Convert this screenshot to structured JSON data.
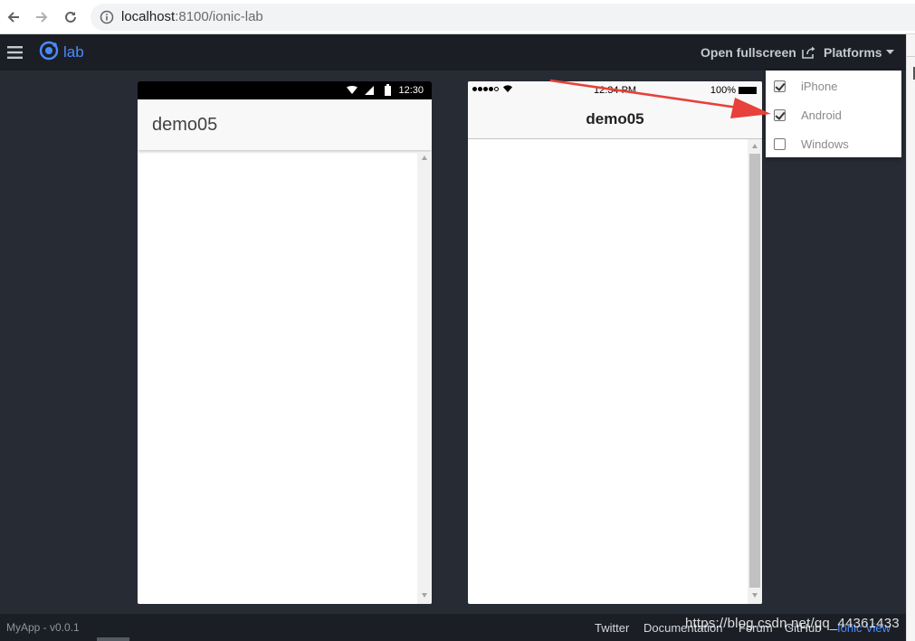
{
  "browser": {
    "url_host": "localhost",
    "url_rest": ":8100/ionic-lab"
  },
  "header": {
    "logo_text": "lab",
    "fullscreen_label": "Open fullscreen",
    "platforms_label": "Platforms"
  },
  "platform_menu": {
    "items": [
      {
        "label": "iPhone",
        "checked": true
      },
      {
        "label": "Android",
        "checked": true
      },
      {
        "label": "Windows",
        "checked": false
      }
    ]
  },
  "android": {
    "time": "12:30",
    "title": "demo05"
  },
  "iphone": {
    "time": "12:34 PM",
    "battery": "100%",
    "title": "demo05"
  },
  "footer": {
    "version": "MyApp - v0.0.1",
    "links": [
      "Twitter",
      "Documentation",
      "Forum",
      "GitHub",
      "Ionic View"
    ],
    "watermark": "https://blog.csdn.net/qq_44361433"
  },
  "colors": {
    "accent": "#4a8bfc",
    "header_bg": "#1b1f25",
    "body_bg": "#272b33",
    "annotation": "#e8403a"
  },
  "icons": [
    "back-arrow-icon",
    "forward-arrow-icon",
    "reload-icon",
    "info-icon",
    "menu-icon",
    "ionic-logo-icon",
    "external-link-icon",
    "caret-down-icon",
    "wifi-icon",
    "signal-icon",
    "battery-icon"
  ]
}
